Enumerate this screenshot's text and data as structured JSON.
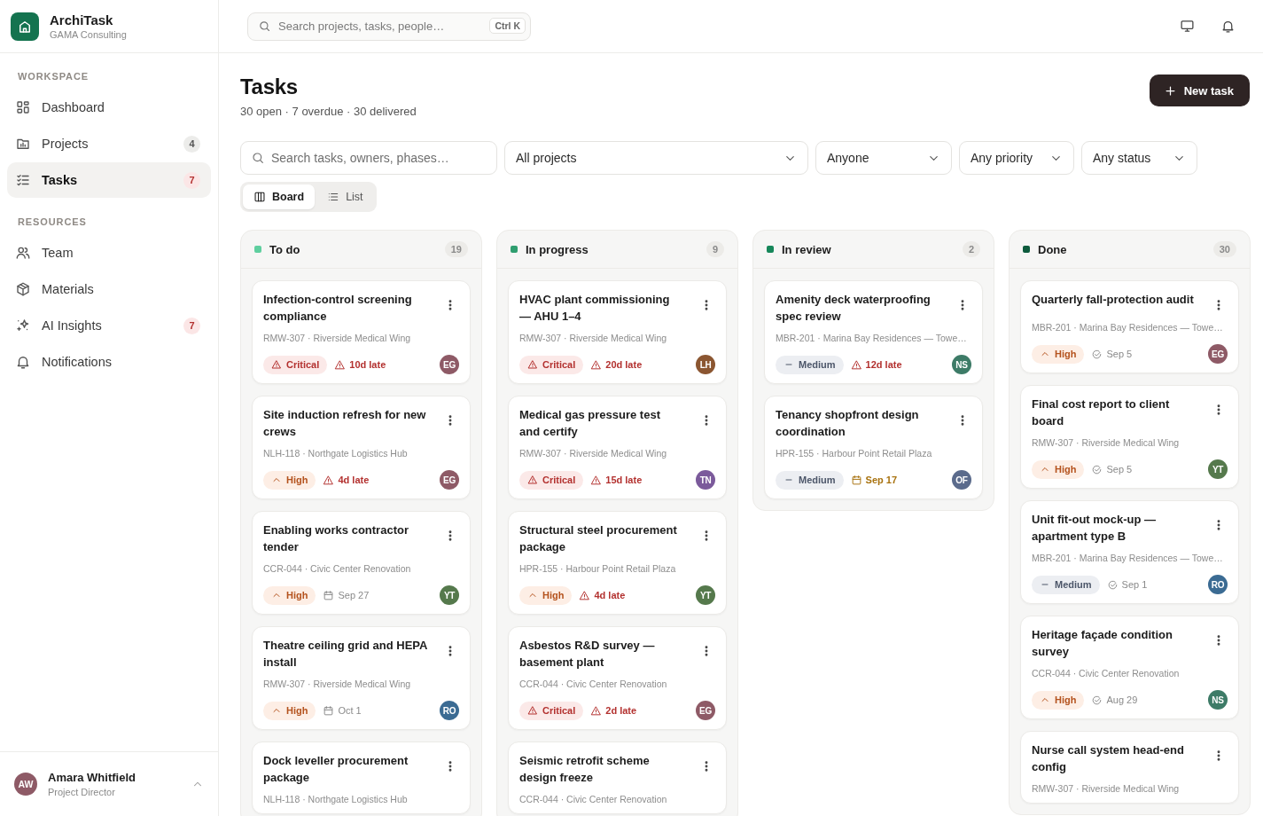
{
  "brand": {
    "name": "ArchiTask",
    "org": "GAMA Consulting"
  },
  "sidebar": {
    "sections": [
      {
        "title": "WORKSPACE",
        "items": [
          {
            "label": "Dashboard",
            "selected": false
          },
          {
            "label": "Projects",
            "selected": false,
            "badge": {
              "text": "4",
              "kind": "neutral"
            }
          },
          {
            "label": "Tasks",
            "selected": true,
            "badge": {
              "text": "7",
              "kind": "alert"
            }
          }
        ]
      },
      {
        "title": "RESOURCES",
        "items": [
          {
            "label": "Team",
            "selected": false
          },
          {
            "label": "Materials",
            "selected": false
          },
          {
            "label": "AI Insights",
            "selected": false,
            "badge": {
              "text": "7",
              "kind": "alert"
            }
          },
          {
            "label": "Notifications",
            "selected": false
          }
        ]
      }
    ],
    "user": {
      "initials": "AW",
      "color": "#8e5a66",
      "name": "Amara Whitfield",
      "role": "Project Director"
    }
  },
  "topbar": {
    "search": {
      "placeholder": "Search projects, tasks, people…",
      "shortcut": "Ctrl K"
    }
  },
  "page": {
    "title": "Tasks",
    "summary": "30 open · 7 overdue · 30 delivered",
    "new_button": "New task"
  },
  "filters": {
    "search": {
      "placeholder": "Search tasks, owners, phases…"
    },
    "dropdowns": [
      "All projects",
      "Anyone",
      "Any priority",
      "Any status"
    ]
  },
  "views": [
    {
      "label": "Board",
      "selected": true
    },
    {
      "label": "List",
      "selected": false
    }
  ],
  "columns": [
    {
      "title": "To do",
      "count": "19",
      "color": "#5fcf9f",
      "cards": [
        {
          "title": "Infection-control screening compliance",
          "project": "RMW-307 · Riverside Medical Wing",
          "priority": {
            "kind": "critical",
            "label": "Critical"
          },
          "due": {
            "kind": "late",
            "label": "10d late"
          },
          "assignee": {
            "initials": "EG",
            "color": "#8e5a66"
          }
        },
        {
          "title": "Site induction refresh for new crews",
          "project": "NLH-118 · Northgate Logistics Hub",
          "priority": {
            "kind": "high",
            "label": "High"
          },
          "due": {
            "kind": "late",
            "label": "4d late"
          },
          "assignee": {
            "initials": "EG",
            "color": "#8e5a66"
          }
        },
        {
          "title": "Enabling works contractor tender",
          "project": "CCR-044 · Civic Center Renovation",
          "priority": {
            "kind": "high",
            "label": "High"
          },
          "due": {
            "kind": "date",
            "label": "Sep 27"
          },
          "assignee": {
            "initials": "YT",
            "color": "#55794c"
          }
        },
        {
          "title": "Theatre ceiling grid and HEPA install",
          "project": "RMW-307 · Riverside Medical Wing",
          "priority": {
            "kind": "high",
            "label": "High"
          },
          "due": {
            "kind": "date",
            "label": "Oct 1"
          },
          "assignee": {
            "initials": "RO",
            "color": "#3b6b93"
          }
        },
        {
          "title": "Dock leveller procurement package",
          "project": "NLH-118 · Northgate Logistics Hub"
        }
      ]
    },
    {
      "title": "In progress",
      "count": "9",
      "color": "#2f9e6f",
      "cards": [
        {
          "title": "HVAC plant commissioning — AHU 1–4",
          "project": "RMW-307 · Riverside Medical Wing",
          "priority": {
            "kind": "critical",
            "label": "Critical"
          },
          "due": {
            "kind": "late",
            "label": "20d late"
          },
          "assignee": {
            "initials": "LH",
            "color": "#8b5631"
          }
        },
        {
          "title": "Medical gas pressure test and certify",
          "project": "RMW-307 · Riverside Medical Wing",
          "priority": {
            "kind": "critical",
            "label": "Critical"
          },
          "due": {
            "kind": "late",
            "label": "15d late"
          },
          "assignee": {
            "initials": "TN",
            "color": "#7b5a9b"
          }
        },
        {
          "title": "Structural steel procurement package",
          "project": "HPR-155 · Harbour Point Retail Plaza",
          "priority": {
            "kind": "high",
            "label": "High"
          },
          "due": {
            "kind": "late",
            "label": "4d late"
          },
          "assignee": {
            "initials": "YT",
            "color": "#55794c"
          }
        },
        {
          "title": "Asbestos R&D survey — basement plant",
          "project": "CCR-044 · Civic Center Renovation",
          "priority": {
            "kind": "critical",
            "label": "Critical"
          },
          "due": {
            "kind": "late",
            "label": "2d late"
          },
          "assignee": {
            "initials": "EG",
            "color": "#8e5a66"
          }
        },
        {
          "title": "Seismic retrofit scheme design freeze",
          "project": "CCR-044 · Civic Center Renovation"
        }
      ]
    },
    {
      "title": "In review",
      "count": "2",
      "color": "#16875a",
      "cards": [
        {
          "title": "Amenity deck waterproofing spec review",
          "project": "MBR-201 · Marina Bay Residences — Towe…",
          "priority": {
            "kind": "medium",
            "label": "Medium"
          },
          "due": {
            "kind": "late",
            "label": "12d late"
          },
          "assignee": {
            "initials": "NS",
            "color": "#3d7b67"
          }
        },
        {
          "title": "Tenancy shopfront design coordination",
          "project": "HPR-155 · Harbour Point Retail Plaza",
          "priority": {
            "kind": "medium",
            "label": "Medium"
          },
          "due": {
            "kind": "soon",
            "label": "Sep 17"
          },
          "assignee": {
            "initials": "OF",
            "color": "#5b6b8c"
          }
        }
      ]
    },
    {
      "title": "Done",
      "count": "30",
      "color": "#0e5b3d",
      "cards": [
        {
          "title": "Quarterly fall-protection audit",
          "project": "MBR-201 · Marina Bay Residences — Towe…",
          "priority": {
            "kind": "high",
            "label": "High"
          },
          "due": {
            "kind": "done",
            "label": "Sep 5"
          },
          "assignee": {
            "initials": "EG",
            "color": "#8e5a66"
          }
        },
        {
          "title": "Final cost report to client board",
          "project": "RMW-307 · Riverside Medical Wing",
          "priority": {
            "kind": "high",
            "label": "High"
          },
          "due": {
            "kind": "done",
            "label": "Sep 5"
          },
          "assignee": {
            "initials": "YT",
            "color": "#55794c"
          }
        },
        {
          "title": "Unit fit-out mock-up — apartment type B",
          "project": "MBR-201 · Marina Bay Residences — Towe…",
          "priority": {
            "kind": "medium",
            "label": "Medium"
          },
          "due": {
            "kind": "done",
            "label": "Sep 1"
          },
          "assignee": {
            "initials": "RO",
            "color": "#3b6b93"
          }
        },
        {
          "title": "Heritage façade condition survey",
          "project": "CCR-044 · Civic Center Renovation",
          "priority": {
            "kind": "high",
            "label": "High"
          },
          "due": {
            "kind": "done",
            "label": "Aug 29"
          },
          "assignee": {
            "initials": "NS",
            "color": "#3d7b67"
          }
        },
        {
          "title": "Nurse call system head-end config",
          "project": "RMW-307 · Riverside Medical Wing"
        }
      ]
    }
  ]
}
